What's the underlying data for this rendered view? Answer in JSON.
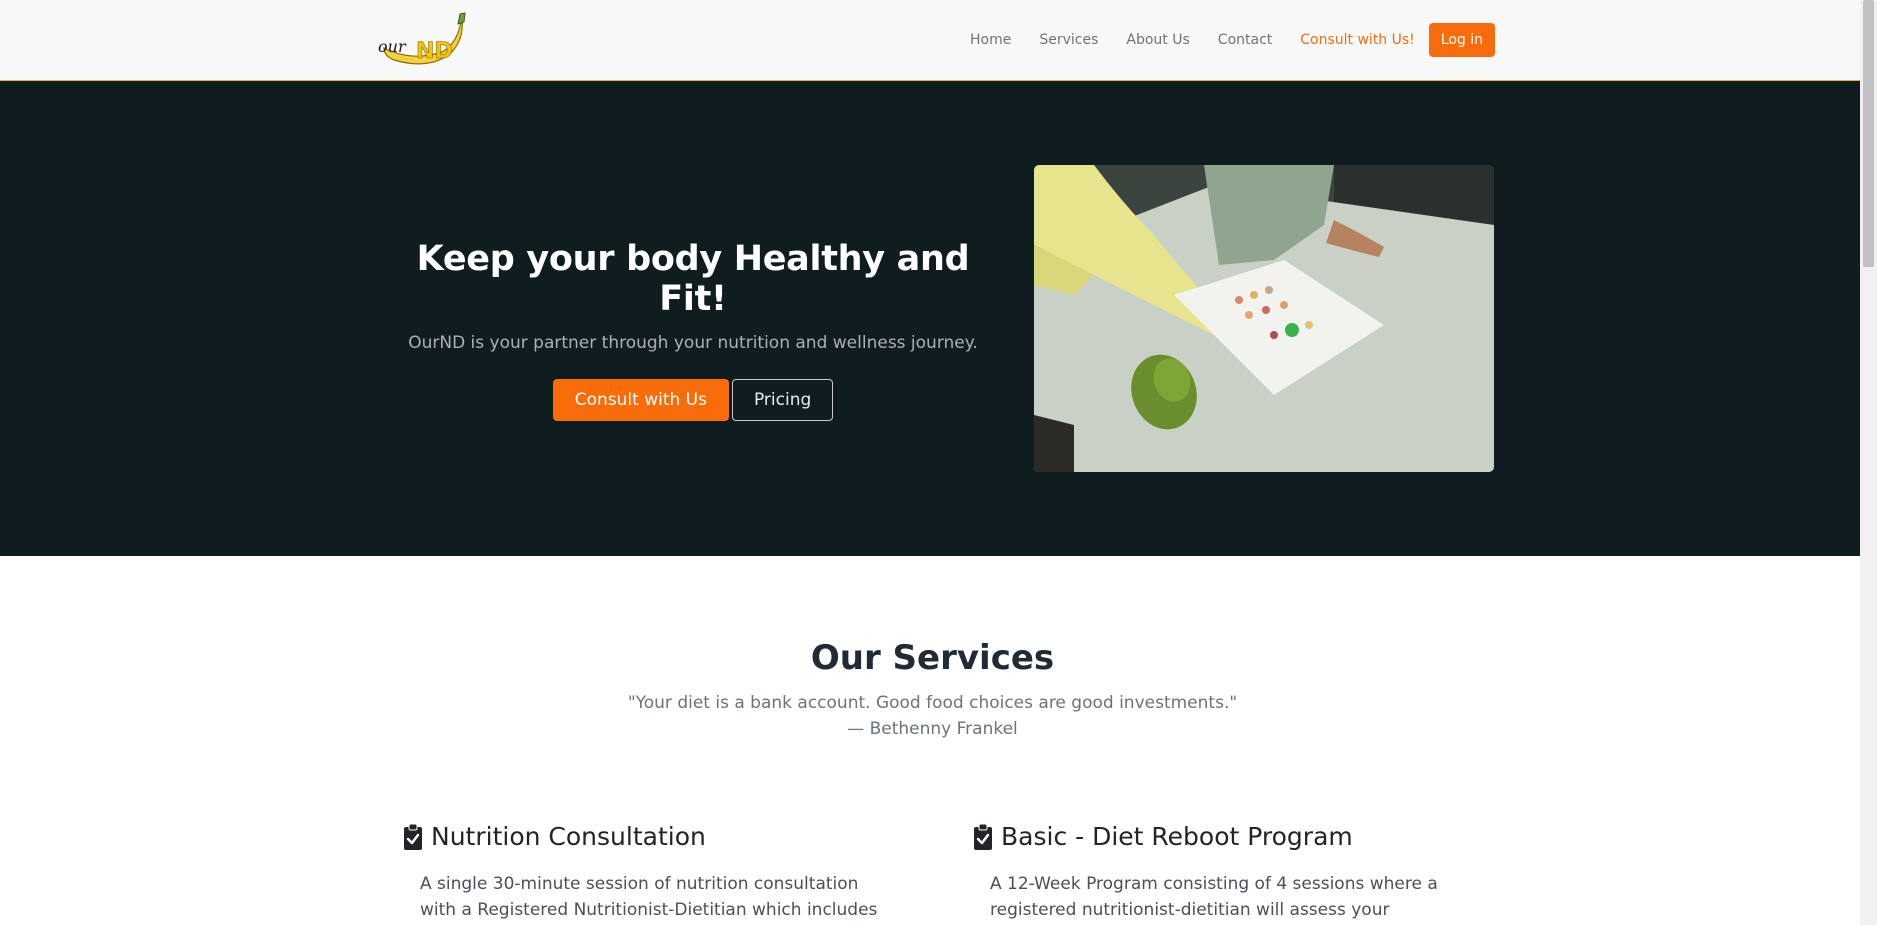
{
  "nav": {
    "logo_text": "ourND",
    "links": [
      {
        "label": "Home"
      },
      {
        "label": "Services"
      },
      {
        "label": "About Us"
      },
      {
        "label": "Contact"
      }
    ],
    "consult_link": "Consult with Us!",
    "login_button": "Log in"
  },
  "hero": {
    "title": "Keep your body Healthy and Fit!",
    "subtitle": "OurND is your partner through your nutrition and wellness journey.",
    "primary_button": "Consult with Us",
    "secondary_button": "Pricing"
  },
  "services": {
    "title": "Our Services",
    "quote": "\"Your diet is a bank account. Good food choices are good investments.\"",
    "quote_author": "— Bethenny Frankel",
    "items": [
      {
        "title": "Nutrition Consultation",
        "description": "A single 30-minute session of nutrition consultation with a Registered Nutritionist-Dietitian which includes a"
      },
      {
        "title": "Basic - Diet Reboot Program",
        "description": "A 12-Week Program consisting of 4 sessions where a registered nutritionist-dietitian will assess your nutrition"
      }
    ]
  },
  "colors": {
    "accent": "#f86d0a",
    "hero_bg": "#0f1c20",
    "navbar_bg": "#f8f8f8"
  },
  "icons": [
    "clipboard-check-icon",
    "logo-icon"
  ]
}
